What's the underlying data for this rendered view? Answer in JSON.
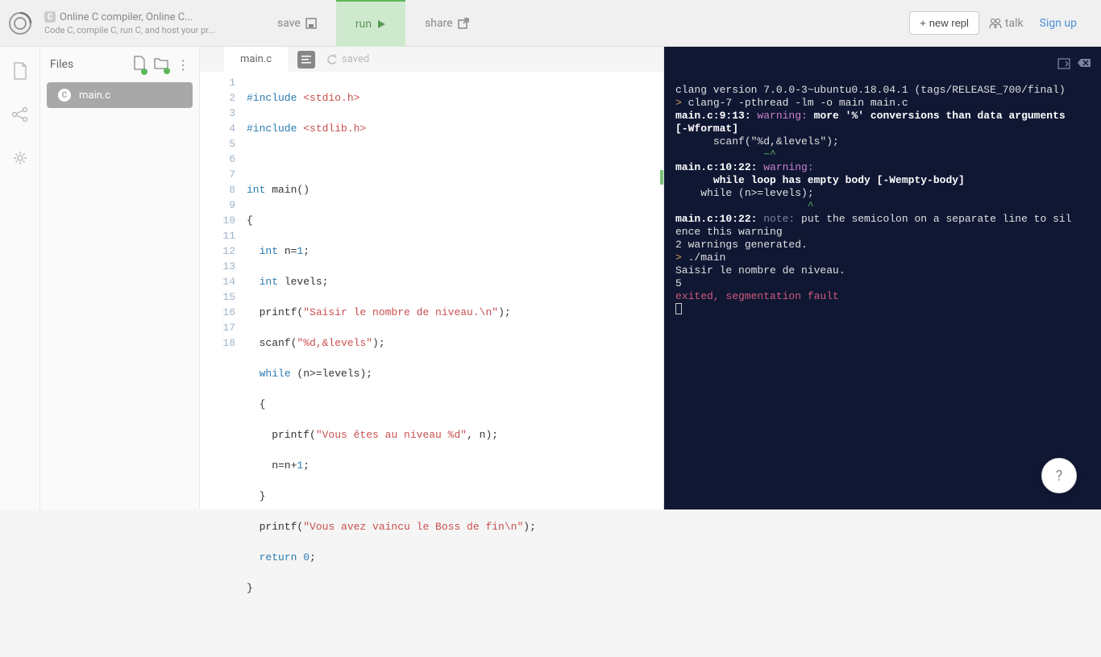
{
  "header": {
    "title": "Online C compiler, Online C...",
    "subtitle": "Code C, compile C, run C, and host your pr...",
    "save": "save",
    "run": "run",
    "share": "share",
    "new_repl": "new repl",
    "talk": "talk",
    "signup": "Sign up"
  },
  "files": {
    "title": "Files",
    "active": "main.c"
  },
  "editor": {
    "tab": "main.c",
    "saved": "saved",
    "lines": [
      "1",
      "2",
      "3",
      "4",
      "5",
      "6",
      "7",
      "8",
      "9",
      "10",
      "11",
      "12",
      "13",
      "14",
      "15",
      "16",
      "17",
      "18"
    ]
  },
  "code": {
    "l1a": "#include ",
    "l1b": "<stdio.h>",
    "l2a": "#include ",
    "l2b": "<stdlib.h>",
    "l4a": "int",
    "l4b": " main()",
    "l5": "{",
    "l6a": "int",
    "l6b": " n=",
    "l6c": "1",
    "l6d": ";",
    "l7a": "int",
    "l7b": " levels;",
    "l8a": "  printf(",
    "l8b": "\"Saisir le nombre de niveau.\\n\"",
    "l8c": ");",
    "l9a": "  scanf(",
    "l9b": "\"%d,&levels\"",
    "l9c": ");",
    "l10a": "while",
    "l10b": " (n>=levels);",
    "l11": "  {",
    "l12a": "    printf(",
    "l12b": "\"Vous êtes au niveau %d\"",
    "l12c": ", n);",
    "l13a": "    n=n+",
    "l13b": "1",
    "l13c": ";",
    "l14": "  }",
    "l15a": "  printf(",
    "l15b": "\"Vous avez vaincu le Boss de fin\\n\"",
    "l15c": ");",
    "l16a": "return",
    "l16b": " ",
    "l16c": "0",
    "l16d": ";",
    "l17": "}"
  },
  "console": {
    "l1": "clang version 7.0.0-3~ubuntu0.18.04.1 (tags/RELEASE_700/final)",
    "l2": " clang-7 -pthread -lm -o main main.c",
    "l3a": "main.c:9:13: ",
    "l3b": "warning: ",
    "l3c": "more '%' conversions than data arguments [-Wformat]",
    "l4": "      scanf(\"%d,&levels\");",
    "l5a": "              ",
    "l5b": "~^",
    "l6a": "main.c:10:22: ",
    "l6b": "warning: ",
    "l7": "      while loop has empty body [-Wempty-body]",
    "l8": "    while (n>=levels);",
    "l9a": "                     ",
    "l9b": "^",
    "l10a": "main.c:10:22: ",
    "l10b": "note: ",
    "l10c": "put the semicolon on a separate line to silence this warning",
    "l11": "2 warnings generated.",
    "l12": " ./main",
    "l13": "Saisir le nombre de niveau.",
    "l14": "5",
    "l15": "exited, segmentation fault"
  },
  "help": "?"
}
